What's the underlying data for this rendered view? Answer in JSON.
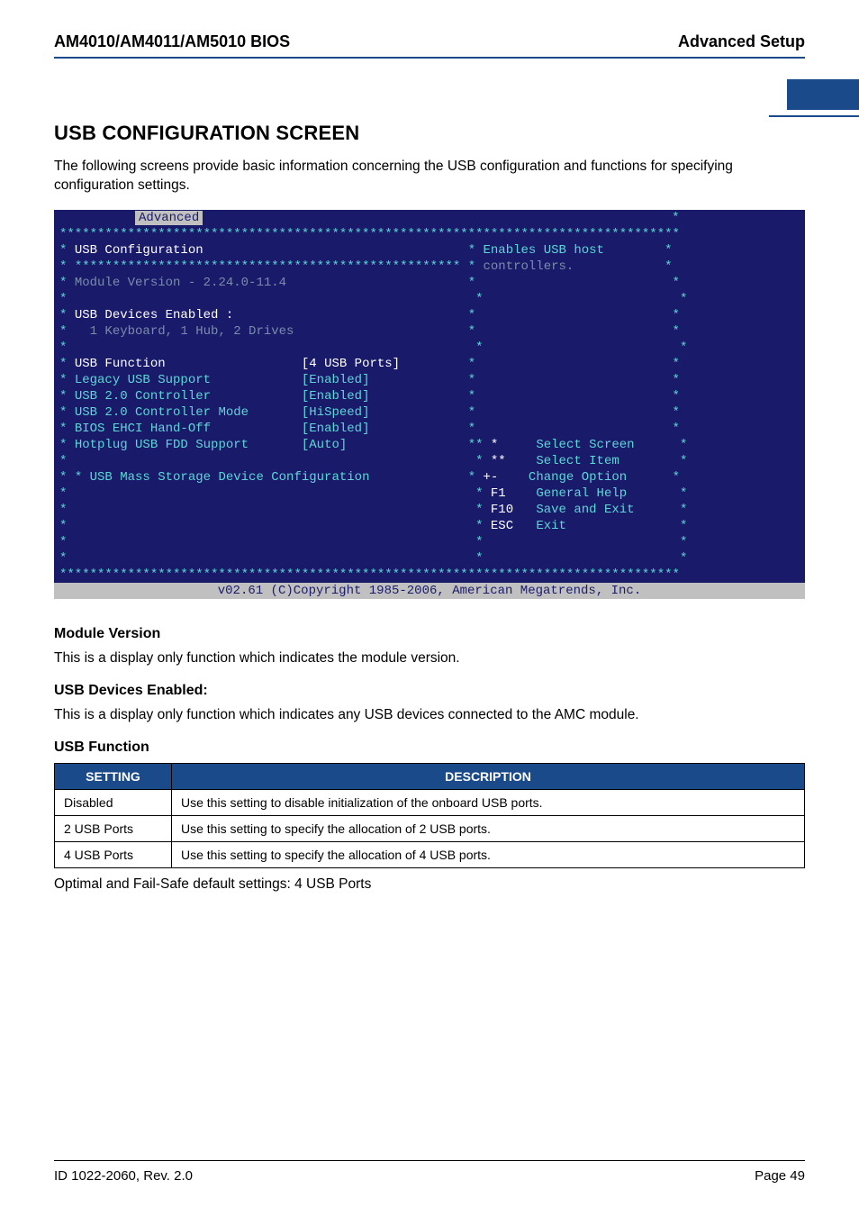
{
  "header": {
    "left": "AM4010/AM4011/AM5010 BIOS",
    "right": "Advanced Setup"
  },
  "section_title": "USB CONFIGURATION SCREEN",
  "intro_text": "The following screens provide basic information concerning the USB configuration and functions for specifying configuration settings.",
  "bios": {
    "tab": "Advanced",
    "title": "USB Configuration",
    "help_line1": "Enables USB host",
    "help_line2": "controllers.",
    "module_version_label": "Module Version - 2.24.0-11.4",
    "devices_enabled_label": "USB Devices Enabled :",
    "devices_enabled_value": "1 Keyboard, 1 Hub, 2 Drives",
    "options": [
      {
        "label": "USB Function",
        "value": "[4 USB Ports]",
        "hl": true
      },
      {
        "label": "Legacy USB Support",
        "value": "[Enabled]",
        "hl": false
      },
      {
        "label": "USB 2.0 Controller",
        "value": "[Enabled]",
        "hl": false
      },
      {
        "label": "USB 2.0 Controller Mode",
        "value": "[HiSpeed]",
        "hl": false
      },
      {
        "label": "BIOS EHCI Hand-Off",
        "value": "[Enabled]",
        "hl": false
      },
      {
        "label": "Hotplug USB FDD Support",
        "value": "[Auto]",
        "hl": false
      }
    ],
    "submenu": "USB Mass Storage Device Configuration",
    "nav": [
      {
        "key": "*",
        "action": "Select Screen"
      },
      {
        "key": "**",
        "action": "Select Item"
      },
      {
        "key": "+-",
        "action": "Change Option"
      },
      {
        "key": "F1",
        "action": "General Help"
      },
      {
        "key": "F10",
        "action": "Save and Exit"
      },
      {
        "key": "ESC",
        "action": "Exit"
      }
    ],
    "copyright": "v02.61 (C)Copyright 1985-2006, American Megatrends, Inc."
  },
  "sections": {
    "module_version": {
      "heading": "Module Version",
      "text": "This is a display only function which indicates the module version."
    },
    "usb_devices_enabled": {
      "heading": "USB Devices Enabled:",
      "text": "This is a display only function which indicates any USB devices connected to the AMC module."
    },
    "usb_function": {
      "heading": "USB Function",
      "table_headers": {
        "setting": "SETTING",
        "description": "DESCRIPTION"
      },
      "rows": [
        {
          "setting": "Disabled",
          "description": "Use this setting to disable initialization of the onboard USB ports."
        },
        {
          "setting": "2 USB Ports",
          "description": "Use this setting to specify the allocation of 2 USB ports."
        },
        {
          "setting": "4 USB Ports",
          "description": "Use this setting to specify the allocation of 4 USB ports."
        }
      ],
      "defaults_note": "Optimal and Fail-Safe default settings: 4 USB Ports"
    }
  },
  "footer": {
    "left": "ID 1022-2060, Rev. 2.0",
    "right": "Page 49"
  }
}
